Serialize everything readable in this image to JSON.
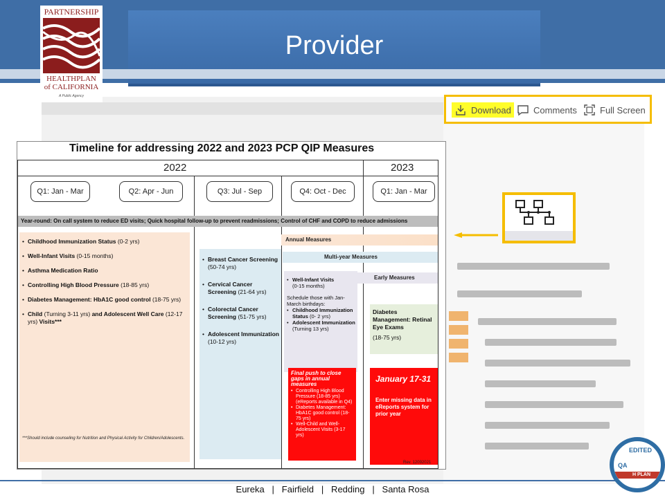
{
  "header": {
    "title": "Provider",
    "logo": {
      "top": "PARTNERSHIP",
      "bottom1": "HEALTHPLAN",
      "bottom2": "of CALIFORNIA",
      "sub": "A Public Agency"
    }
  },
  "toolbar": {
    "download": "Download",
    "comments": "Comments",
    "fullscreen": "Full Screen"
  },
  "slide": {
    "title": "Timeline for addressing 2022 and 2023 PCP QIP Measures",
    "years": [
      "2022",
      "2023"
    ],
    "quarters": [
      "Q1: Jan - Mar",
      "Q2: Apr - Jun",
      "Q3: Jul - Sep",
      "Q4: Oct - Dec",
      "Q1: Jan - Mar"
    ],
    "year_round": "Year-round:  On call system to reduce ED visits; Quick hospital follow-up to prevent readmissions; Control of CHF and COPD to reduce admissions",
    "arrows": {
      "annual": "Annual Measures",
      "multi": "Multi-year Measures",
      "early": "Early Measures"
    },
    "annual_list": [
      {
        "b": "Childhood Immunization Status",
        "n": " (0-2 yrs)"
      },
      {
        "b": "Well-Infant Visits",
        "n": " (0-15 months)"
      },
      {
        "b": "Asthma Medication Ratio",
        "n": ""
      },
      {
        "b": "Controlling High Blood Pressure",
        "n": " (18-85 yrs)"
      },
      {
        "b": "Diabetes Management: HbA1C good control",
        "n": " (18-75 yrs)"
      },
      {
        "b": "Child",
        "n": " (Turning 3-11 yrs) ",
        "b2": "and Adolescent Well Care",
        "n2": " (12-17 yrs) ",
        "b3": "Visits***"
      }
    ],
    "multi_list": [
      {
        "b": "Breast Cancer Screening",
        "n": " (50-74 yrs)"
      },
      {
        "b": "Cervical Cancer Screening",
        "n": " (21-64 yrs)"
      },
      {
        "b": "Colorectal Cancer Screening",
        "n": " (51-75 yrs)"
      },
      {
        "b": "Adolescent Immunization",
        "n": " (10-12 yrs)"
      }
    ],
    "early": {
      "well_infant": "Well-Infant Visits",
      "well_infant_age": "(0-15 months)",
      "schedule": "Schedule those with Jan-March birthdays:",
      "child_imm": "Childhood Immunization Status",
      "child_imm_age": "(0- 2 yrs)",
      "adol_imm": "Adolescent Immunization",
      "adol_imm_age": "(Turning 13 yrs)"
    },
    "diabetes_eye": {
      "title": "Diabetes Management: Retinal Eye Exams",
      "age": "(18-75 yrs)"
    },
    "final_push": {
      "title": "Final push to close gaps in annual measures",
      "items": [
        "Controlling High Blood Pressure (18-85 yrs) (eReports available in Q4)",
        "Diabetes Management: HbA1C good control (18-75 yrs)",
        "Well-Child and Well-Adolescent Visits (3-17 yrs)"
      ]
    },
    "january": {
      "title": "January 17-31",
      "text": "Enter missing data in eReports system for prior year"
    },
    "footnote": "***Should include counseling for Nutrition and Physical Activity for Children/Adolescents.",
    "rev": "Rev. 12092021"
  },
  "footer": "Eureka   |   Fairfield   |   Redding   |   Santa Rosa",
  "badge": {
    "text": "EDITED",
    "band": "H PLAN",
    "ncqa": "QA"
  },
  "colors": {
    "header": "#3f6ea6",
    "highlight": "#f5bd00",
    "red": "#ff0a0a"
  }
}
